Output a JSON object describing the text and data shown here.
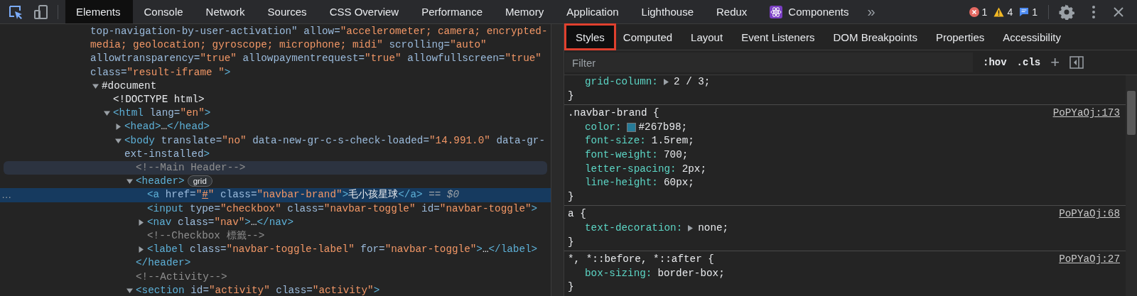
{
  "toolbar": {
    "tools": [
      {
        "kind": "inspect",
        "selected": true
      },
      {
        "kind": "device",
        "selected": false
      }
    ],
    "tabs": [
      {
        "label": "Elements",
        "selected": true
      },
      {
        "label": "Console",
        "selected": false
      },
      {
        "label": "Network",
        "selected": false
      },
      {
        "label": "Sources",
        "selected": false
      },
      {
        "label": "CSS Overview",
        "selected": false
      },
      {
        "label": "Performance",
        "selected": false
      },
      {
        "label": "Memory",
        "selected": false
      },
      {
        "label": "Application",
        "selected": false
      },
      {
        "label": "Lighthouse",
        "selected": false
      },
      {
        "label": "Redux",
        "selected": false
      },
      {
        "label": "Components",
        "selected": false,
        "kind": "react"
      }
    ],
    "overflow": "»",
    "issues": [
      {
        "kind": "error",
        "count": "1"
      },
      {
        "kind": "warning",
        "count": "4"
      },
      {
        "kind": "info",
        "count": "1"
      }
    ]
  },
  "dom_tree": [
    {
      "selected": false,
      "hovered": false,
      "segments": [
        {
          "kind": "attr",
          "text": "top-navigation-by-user-activation\" allow="
        },
        {
          "kind": "val",
          "text": "\"accelerometer; camera; encrypted-media; geolocation; gyroscope; microphone; midi\""
        },
        {
          "kind": "attr",
          "text": " scrolling="
        },
        {
          "kind": "val",
          "text": "\"auto\""
        },
        {
          "kind": "attr",
          "text": " allowtransparency="
        },
        {
          "kind": "val",
          "text": "\"true\""
        },
        {
          "kind": "attr",
          "text": " allowpaymentrequest="
        },
        {
          "kind": "val",
          "text": "\"true\""
        },
        {
          "kind": "attr",
          "text": " allowfullscreen="
        },
        {
          "kind": "val",
          "text": "\"true\""
        },
        {
          "kind": "attr",
          "text": " class="
        },
        {
          "kind": "val",
          "text": "\"result-iframe \""
        },
        {
          "kind": "tag",
          "text": ">"
        }
      ],
      "children": [
        {
          "selected": false,
          "hovered": false,
          "expanded": true,
          "segments": [
            {
              "kind": "text",
              "text": "#document"
            }
          ],
          "children": [
            {
              "selected": false,
              "hovered": false,
              "segments": [
                {
                  "kind": "text",
                  "text": "<!DOCTYPE html>"
                }
              ]
            },
            {
              "selected": false,
              "hovered": false,
              "expanded": true,
              "segments": [
                {
                  "kind": "tag",
                  "text": "<html"
                },
                {
                  "kind": "attr",
                  "text": " lang="
                },
                {
                  "kind": "val",
                  "text": "\"en\""
                },
                {
                  "kind": "tag",
                  "text": ">"
                }
              ],
              "children": [
                {
                  "selected": false,
                  "hovered": false,
                  "expanded": false,
                  "segments": [
                    {
                      "kind": "tag",
                      "text": "<head>"
                    },
                    {
                      "kind": "text",
                      "text": "…"
                    },
                    {
                      "kind": "tag",
                      "text": "</head>"
                    }
                  ]
                },
                {
                  "selected": false,
                  "hovered": false,
                  "expanded": true,
                  "segments": [
                    {
                      "kind": "tag",
                      "text": "<body"
                    },
                    {
                      "kind": "attr",
                      "text": " translate="
                    },
                    {
                      "kind": "val",
                      "text": "\"no\""
                    },
                    {
                      "kind": "attr",
                      "text": " data-new-gr-c-s-check-loaded="
                    },
                    {
                      "kind": "val",
                      "text": "\"14.991.0\""
                    },
                    {
                      "kind": "attr",
                      "text": " data-gr-ext-installed"
                    },
                    {
                      "kind": "tag",
                      "text": ">"
                    }
                  ],
                  "children": [
                    {
                      "selected": false,
                      "hovered": true,
                      "segments": [
                        {
                          "kind": "comment",
                          "text": "<!--Main Header-->"
                        }
                      ]
                    },
                    {
                      "selected": false,
                      "hovered": false,
                      "expanded": true,
                      "badge": "grid",
                      "segments": [
                        {
                          "kind": "tag",
                          "text": "<header>"
                        }
                      ],
                      "children": [
                        {
                          "selected": true,
                          "hovered": false,
                          "gutter": "…",
                          "segments": [
                            {
                              "kind": "tag",
                              "text": "<a"
                            },
                            {
                              "kind": "attr",
                              "text": " href="
                            },
                            {
                              "kind": "val",
                              "text": "\""
                            },
                            {
                              "kind": "link",
                              "text": "#"
                            },
                            {
                              "kind": "val",
                              "text": "\""
                            },
                            {
                              "kind": "attr",
                              "text": " class="
                            },
                            {
                              "kind": "val",
                              "text": "\"navbar-brand\""
                            },
                            {
                              "kind": "tag",
                              "text": ">"
                            },
                            {
                              "kind": "text",
                              "text": "毛小孩星球"
                            },
                            {
                              "kind": "tag",
                              "text": "</a>"
                            },
                            {
                              "kind": "marker",
                              "text": " == $0"
                            }
                          ]
                        },
                        {
                          "selected": false,
                          "hovered": false,
                          "segments": [
                            {
                              "kind": "tag",
                              "text": "<input"
                            },
                            {
                              "kind": "attr",
                              "text": " type="
                            },
                            {
                              "kind": "val",
                              "text": "\"checkbox\""
                            },
                            {
                              "kind": "attr",
                              "text": " class="
                            },
                            {
                              "kind": "val",
                              "text": "\"navbar-toggle\""
                            },
                            {
                              "kind": "attr",
                              "text": " id="
                            },
                            {
                              "kind": "val",
                              "text": "\"navbar-toggle\""
                            },
                            {
                              "kind": "tag",
                              "text": ">"
                            }
                          ]
                        },
                        {
                          "selected": false,
                          "hovered": false,
                          "expanded": false,
                          "segments": [
                            {
                              "kind": "tag",
                              "text": "<nav"
                            },
                            {
                              "kind": "attr",
                              "text": " class="
                            },
                            {
                              "kind": "val",
                              "text": "\"nav\""
                            },
                            {
                              "kind": "tag",
                              "text": ">"
                            },
                            {
                              "kind": "text",
                              "text": "…"
                            },
                            {
                              "kind": "tag",
                              "text": "</nav>"
                            }
                          ]
                        },
                        {
                          "selected": false,
                          "hovered": false,
                          "segments": [
                            {
                              "kind": "comment",
                              "text": "<!--Checkbox 標籤-->"
                            }
                          ]
                        },
                        {
                          "selected": false,
                          "hovered": false,
                          "expanded": false,
                          "segments": [
                            {
                              "kind": "tag",
                              "text": "<label"
                            },
                            {
                              "kind": "attr",
                              "text": " class="
                            },
                            {
                              "kind": "val",
                              "text": "\"navbar-toggle-label\""
                            },
                            {
                              "kind": "attr",
                              "text": " for="
                            },
                            {
                              "kind": "val",
                              "text": "\"navbar-toggle\""
                            },
                            {
                              "kind": "tag",
                              "text": ">"
                            },
                            {
                              "kind": "text",
                              "text": "…"
                            },
                            {
                              "kind": "tag",
                              "text": "</label>"
                            }
                          ]
                        }
                      ],
                      "closing": [
                        {
                          "kind": "tag",
                          "text": "</header>"
                        }
                      ]
                    },
                    {
                      "selected": false,
                      "hovered": false,
                      "segments": [
                        {
                          "kind": "comment",
                          "text": "<!--Activity-->"
                        }
                      ]
                    },
                    {
                      "selected": false,
                      "hovered": false,
                      "expanded": true,
                      "segments": [
                        {
                          "kind": "tag",
                          "text": "<section"
                        },
                        {
                          "kind": "attr",
                          "text": " id="
                        },
                        {
                          "kind": "val",
                          "text": "\"activity\""
                        },
                        {
                          "kind": "attr",
                          "text": " class="
                        },
                        {
                          "kind": "val",
                          "text": "\"activity\""
                        },
                        {
                          "kind": "tag",
                          "text": ">"
                        }
                      ]
                    }
                  ]
                }
              ]
            }
          ]
        }
      ]
    }
  ],
  "styles_pane": {
    "tabs": [
      {
        "label": "Styles",
        "selected": true,
        "outlined": true
      },
      {
        "label": "Computed",
        "selected": false,
        "outlined": false
      },
      {
        "label": "Layout",
        "selected": false,
        "outlined": false
      },
      {
        "label": "Event Listeners",
        "selected": false,
        "outlined": false
      },
      {
        "label": "DOM Breakpoints",
        "selected": false,
        "outlined": false
      },
      {
        "label": "Properties",
        "selected": false,
        "outlined": false
      },
      {
        "label": "Accessibility",
        "selected": false,
        "outlined": false
      }
    ],
    "filter": {
      "placeholder": "Filter"
    },
    "hov": ":hov",
    "cls": ".cls",
    "add": "+",
    "rules": [
      {
        "declarations": [
          {
            "property": "grid-column:",
            "value": "2 / 3;",
            "expandable": true
          }
        ],
        "close": "}"
      },
      {
        "selector": ".navbar-brand {",
        "source": "PoPYaOj:173",
        "declarations": [
          {
            "property": "color:",
            "color": "#267b98",
            "value": ";",
            "expandable": false
          },
          {
            "property": "font-size:",
            "value": "1.5rem;",
            "expandable": false
          },
          {
            "property": "font-weight:",
            "value": "700;",
            "expandable": false
          },
          {
            "property": "letter-spacing:",
            "value": "2px;",
            "expandable": false
          },
          {
            "property": "line-height:",
            "value": "60px;",
            "expandable": false
          }
        ],
        "close": "}"
      },
      {
        "selector": "a {",
        "source": "PoPYaOj:68",
        "declarations": [
          {
            "property": "text-decoration:",
            "value": "none;",
            "expandable": true
          }
        ],
        "close": "}"
      },
      {
        "selector": "*, *::before, *::after {",
        "source": "PoPYaOj:27",
        "declarations": [
          {
            "property": "box-sizing:",
            "value": "border-box;",
            "expandable": false
          }
        ],
        "close": "}"
      }
    ]
  }
}
